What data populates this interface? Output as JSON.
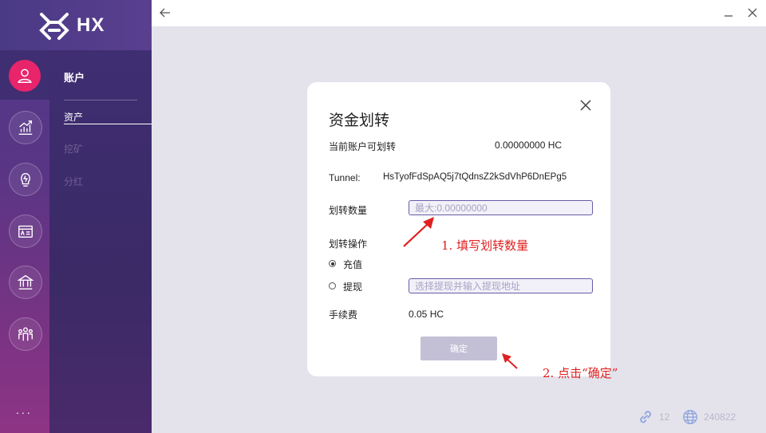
{
  "app": {
    "logo_text": "HX"
  },
  "sidebar": {
    "icons": [
      "user-icon",
      "chart-icon",
      "bulb-icon",
      "id-card-icon",
      "bank-icon",
      "group-icon"
    ],
    "more": "...",
    "section_title": "账户",
    "items": [
      {
        "label": "资产",
        "active": true
      },
      {
        "label": "挖矿",
        "active": false
      },
      {
        "label": "分红",
        "active": false
      }
    ]
  },
  "status": {
    "link_count": "12",
    "block_height": "240822"
  },
  "dialog": {
    "title": "资金划转",
    "transferable_label": "当前账户可划转",
    "transferable_value": "0.00000000 HC",
    "tunnel_label": "Tunnel:",
    "tunnel_value": "HsTyofFdSpAQ5j7tQdnsZ2kSdVhP6DnEPg5",
    "amount_label": "划转数量",
    "amount_placeholder": "最大:0.00000000",
    "operation_label": "划转操作",
    "options": [
      {
        "label": "充值",
        "selected": true
      },
      {
        "label": "提现",
        "selected": false
      }
    ],
    "address_placeholder": "选择提现并输入提现地址",
    "fee_label": "手续费",
    "fee_value": "0.05 HC",
    "confirm_label": "确定"
  },
  "annotations": {
    "step1": "1. 填写划转数量",
    "step2": "2. 点击“确定”",
    "color": "#e02020"
  }
}
